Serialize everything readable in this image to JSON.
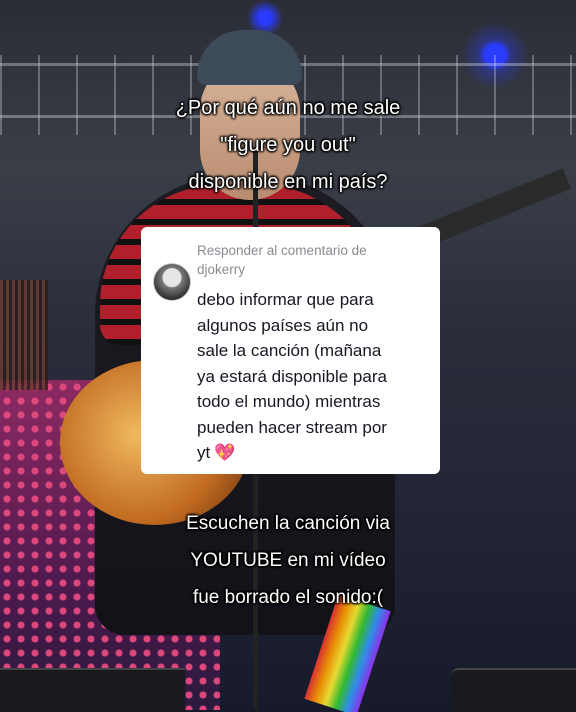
{
  "overlay_top": {
    "lines": [
      "¿Por qué aún no me sale",
      "\"figure you out\"",
      "disponible en mi país?"
    ]
  },
  "reply_card": {
    "header_lines": [
      "Responder al comentario de",
      "djokerry"
    ],
    "body_lines": [
      "debo informar que para",
      "algunos países aún no",
      "sale la canción (mañana",
      "ya estará disponible para",
      "todo el mundo) mientras",
      "pueden hacer stream por",
      "yt"
    ],
    "emoji": "💖"
  },
  "overlay_bottom": {
    "lines": [
      "Escuchen la canción via",
      "YOUTUBE en mi vídeo",
      "fue borrado el sonido:("
    ]
  },
  "colors": {
    "overlay_text": "#ffffff",
    "card_background": "#ffffff",
    "card_header_text": "#8a8b91",
    "card_body_text": "#161823",
    "heart": "#e8318a"
  },
  "icons": {
    "avatar": "profile-avatar",
    "emoji": "sparkling-heart-icon"
  }
}
